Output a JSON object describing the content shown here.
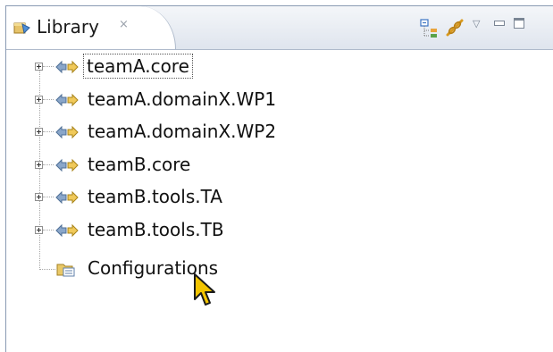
{
  "view": {
    "title": "Library",
    "close_glyph": "×",
    "toolbar": {
      "collapse_icon": "collapse-all-icon",
      "link_icon": "link-with-editor-icon",
      "menu_glyph": "▽"
    }
  },
  "tree": {
    "items": [
      {
        "label": "teamA.core",
        "icon": "plugin-project-icon",
        "expandable": true,
        "focused": true
      },
      {
        "label": "teamA.domainX.WP1",
        "icon": "plugin-project-icon",
        "expandable": true,
        "focused": false
      },
      {
        "label": "teamA.domainX.WP2",
        "icon": "plugin-project-icon",
        "expandable": true,
        "focused": false
      },
      {
        "label": "teamB.core",
        "icon": "plugin-project-icon",
        "expandable": true,
        "focused": false
      },
      {
        "label": "teamB.tools.TA",
        "icon": "plugin-project-icon",
        "expandable": true,
        "focused": false
      },
      {
        "label": "teamB.tools.TB",
        "icon": "plugin-project-icon",
        "expandable": true,
        "focused": false
      }
    ],
    "configurations": {
      "label": "Configurations",
      "icon": "configurations-icon"
    }
  },
  "colors": {
    "header_gradient_top": "#f4f6f9",
    "header_gradient_bottom": "#dfe5ee",
    "border": "#8a9bb3",
    "cursor_fill": "#f2c400"
  }
}
